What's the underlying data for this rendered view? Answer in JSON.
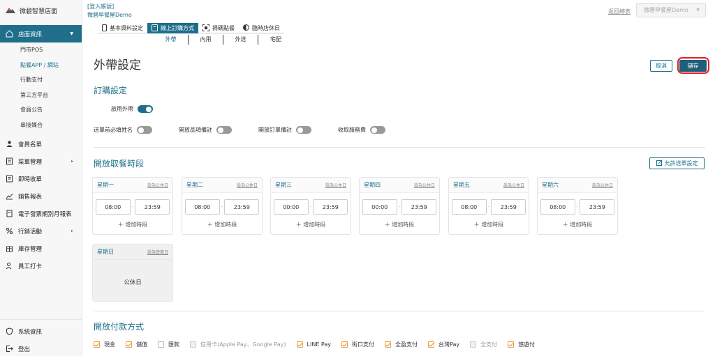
{
  "brand": {
    "name": "微碧智慧店面"
  },
  "sidebar": {
    "active": {
      "label": "店面資訊"
    },
    "sub_items": [
      {
        "label": "門市POS"
      },
      {
        "label": "點餐APP / 網站"
      },
      {
        "label": "行動支付"
      },
      {
        "label": "第三方平台"
      },
      {
        "label": "會員公告"
      },
      {
        "label": "串接媒合"
      }
    ],
    "items": [
      {
        "label": "會員名單"
      },
      {
        "label": "菜單管理"
      },
      {
        "label": "即時收單"
      },
      {
        "label": "銷售報表"
      },
      {
        "label": "電子發票期別月報表"
      },
      {
        "label": "行銷活動"
      },
      {
        "label": "庫存管理"
      },
      {
        "label": "員工打卡"
      }
    ],
    "bottom": [
      {
        "label": "系統資訊"
      },
      {
        "label": "登出"
      }
    ]
  },
  "topbar": {
    "login_link": "[登入帳號]",
    "store_name": "微碧早餐屋Demo",
    "back_link": "返回總表",
    "store_select": "微碧早餐屋Demo"
  },
  "tabs": [
    {
      "label": "基本資料設定"
    },
    {
      "label": "線上訂購方式"
    },
    {
      "label": "掃碼點餐"
    },
    {
      "label": "臨時店休日"
    }
  ],
  "subtabs": [
    {
      "label": "外帶"
    },
    {
      "label": "內用"
    },
    {
      "label": "外送"
    },
    {
      "label": "宅配"
    }
  ],
  "page": {
    "title": "外帶設定",
    "cancel": "取消",
    "save": "儲存"
  },
  "order_settings": {
    "title": "訂購設定",
    "enable_label": "啟用外帶",
    "enable_on": true,
    "toggles": [
      {
        "label": "送單前必填姓名",
        "on": false
      },
      {
        "label": "開放品項備註",
        "on": false
      },
      {
        "label": "開放訂單備註",
        "on": false
      },
      {
        "label": "收取服務費",
        "on": false
      }
    ]
  },
  "pickup_hours": {
    "title": "開放取餐時段",
    "allow_button": "允許送單設定",
    "add_slot": "＋ 增加時段",
    "days": [
      {
        "name": "星期一",
        "link": "設為公休日",
        "start": "08:00",
        "end": "23:59"
      },
      {
        "name": "星期二",
        "link": "設為公休日",
        "start": "08:00",
        "end": "23:59"
      },
      {
        "name": "星期三",
        "link": "設為公休日",
        "start": "00:00",
        "end": "23:59"
      },
      {
        "name": "星期四",
        "link": "設為公休日",
        "start": "00:00",
        "end": "23:59"
      },
      {
        "name": "星期五",
        "link": "設為公休日",
        "start": "08:00",
        "end": "23:59"
      },
      {
        "name": "星期六",
        "link": "設為公休日",
        "start": "08:00",
        "end": "23:59"
      }
    ],
    "sunday": {
      "name": "星期日",
      "link": "設為營業日",
      "status": "公休日"
    }
  },
  "payments": {
    "title": "開放付款方式",
    "methods": [
      {
        "label": "現金",
        "checked": true,
        "disabled": false
      },
      {
        "label": "儲值",
        "checked": true,
        "disabled": false
      },
      {
        "label": "匯款",
        "checked": false,
        "disabled": false
      },
      {
        "label": "信用卡(Apple Pay、Google Pay)",
        "checked": false,
        "disabled": true
      },
      {
        "label": "LINE Pay",
        "checked": true,
        "disabled": false
      },
      {
        "label": "街口支付",
        "checked": true,
        "disabled": false
      },
      {
        "label": "全盈支付",
        "checked": true,
        "disabled": false
      },
      {
        "label": "台灣Pay",
        "checked": true,
        "disabled": false
      },
      {
        "label": "全支付",
        "checked": false,
        "disabled": true
      },
      {
        "label": "悠遊付",
        "checked": true,
        "disabled": false
      }
    ]
  },
  "colors": {
    "accent": "#1f6f8b",
    "save_ring": "#e01e2a",
    "check": "#e8a040"
  }
}
